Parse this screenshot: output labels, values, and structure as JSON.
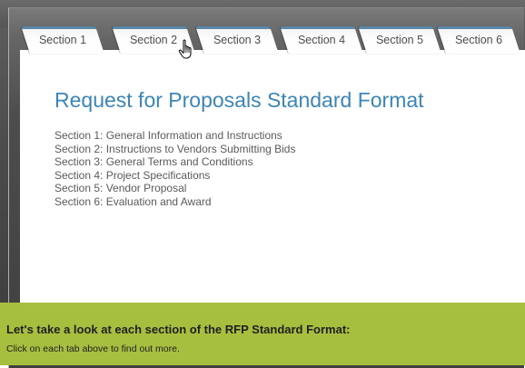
{
  "tabs": [
    {
      "label": "Section 1"
    },
    {
      "label": "Section 2"
    },
    {
      "label": "Section 3"
    },
    {
      "label": "Section 4"
    },
    {
      "label": "Section 5"
    },
    {
      "label": "Section 6"
    }
  ],
  "main": {
    "title": "Request for Proposals Standard Format",
    "sections": [
      "Section 1: General Information and Instructions",
      "Section 2: Instructions to Vendors Submitting Bids",
      "Section 3: General Terms and Conditions",
      "Section 4: Project Specifications",
      "Section 5: Vendor Proposal",
      "Section 6: Evaluation and Award"
    ]
  },
  "footer": {
    "heading": "Let's take a look at each section of the RFP Standard Format:",
    "instruction": "Click on each tab above to find out more."
  },
  "colors": {
    "title": "#3a86b8",
    "tab_accent": "#5a88a8",
    "footer_bg": "#a6bf3f"
  }
}
